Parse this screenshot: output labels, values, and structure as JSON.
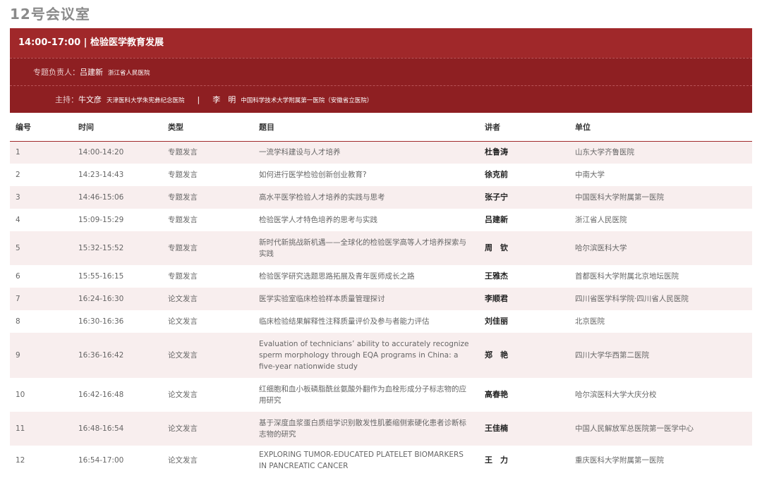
{
  "room": "12号会议室",
  "session": {
    "title": "14:00-17:00 | 检验医学教育发展",
    "lead_label": "专题负责人：",
    "lead_name": "吕建新",
    "lead_org": "浙江省人民医院",
    "host_label": "主持：",
    "host1_name": "牛文彦",
    "host1_org": "天津医科大学朱宪彝纪念医院",
    "separator": "|",
    "host2_name": "李　明",
    "host2_org": "中国科学技术大学附属第一医院（安徽省立医院）"
  },
  "table": {
    "headers": [
      "编号",
      "时间",
      "类型",
      "题目",
      "讲者",
      "单位"
    ],
    "rows": [
      {
        "no": "1",
        "time": "14:00-14:20",
        "type": "专题发言",
        "topic": "一流学科建设与人才培养",
        "speaker": "杜鲁涛",
        "unit": "山东大学齐鲁医院"
      },
      {
        "no": "2",
        "time": "14:23-14:43",
        "type": "专题发言",
        "topic": "如何进行医学检验创新创业教育?",
        "speaker": "徐克前",
        "unit": "中南大学"
      },
      {
        "no": "3",
        "time": "14:46-15:06",
        "type": "专题发言",
        "topic": "高水平医学检验人才培养的实践与思考",
        "speaker": "张子宁",
        "unit": "中国医科大学附属第一医院"
      },
      {
        "no": "4",
        "time": "15:09-15:29",
        "type": "专题发言",
        "topic": "检验医学人才特色培养的思考与实践",
        "speaker": "吕建新",
        "unit": "浙江省人民医院"
      },
      {
        "no": "5",
        "time": "15:32-15:52",
        "type": "专题发言",
        "topic": "新时代新挑战新机遇——全球化的检验医学高等人才培养探索与实践",
        "speaker": "周　钦",
        "unit": "哈尔滨医科大学"
      },
      {
        "no": "6",
        "time": "15:55-16:15",
        "type": "专题发言",
        "topic": "检验医学研究选题思路拓展及青年医师成长之路",
        "speaker": "王雅杰",
        "unit": "首都医科大学附属北京地坛医院"
      },
      {
        "no": "7",
        "time": "16:24-16:30",
        "type": "论文发言",
        "topic": "医学实验室临床检验样本质量管理探讨",
        "speaker": "李顺君",
        "unit": "四川省医学科学院·四川省人民医院"
      },
      {
        "no": "8",
        "time": "16:30-16:36",
        "type": "论文发言",
        "topic": "临床检验结果解释性注释质量评价及参与者能力评估",
        "speaker": "刘佳丽",
        "unit": "北京医院"
      },
      {
        "no": "9",
        "time": "16:36-16:42",
        "type": "论文发言",
        "topic": "Evaluation of technicians’ ability to accurately recognize sperm morphology through EQA programs in China: a five-year nationwide study",
        "speaker": "郑　艳",
        "unit": "四川大学华西第二医院"
      },
      {
        "no": "10",
        "time": "16:42-16:48",
        "type": "论文发言",
        "topic": "红细胞和血小板磷脂酰丝氨酸外翻作为血栓形成分子标志物的应用研究",
        "speaker": "高春艳",
        "unit": "哈尔滨医科大学大庆分校"
      },
      {
        "no": "11",
        "time": "16:48-16:54",
        "type": "论文发言",
        "topic": "基于深度血浆蛋白质组学识别散发性肌萎缩侧索硬化患者诊断标志物的研究",
        "speaker": "王佳楠",
        "unit": "中国人民解放军总医院第一医学中心"
      },
      {
        "no": "12",
        "time": "16:54-17:00",
        "type": "论文发言",
        "topic": "EXPLORING TUMOR-EDUCATED PLATELET BIOMARKERS IN PANCREATIC CANCER",
        "speaker": "王　力",
        "unit": "重庆医科大学附属第一医院"
      }
    ]
  }
}
